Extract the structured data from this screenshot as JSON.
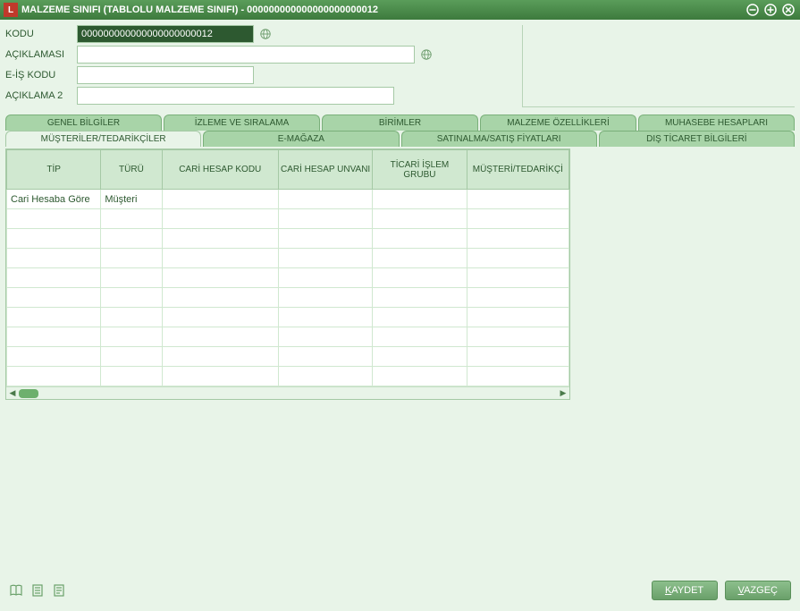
{
  "titlebar": {
    "title": "MALZEME SINIFI (TABLOLU MALZEME SINIFI) - 000000000000000000000012"
  },
  "form": {
    "kodu_label": "KODU",
    "kodu_value": "000000000000000000000012",
    "aciklamasi_label": "AÇIKLAMASI",
    "aciklamasi_value": "",
    "eiskodu_label": "E-İŞ KODU",
    "eiskodu_value": "",
    "aciklama2_label": "AÇIKLAMA 2",
    "aciklama2_value": ""
  },
  "tabs_row1": [
    {
      "label": "GENEL BİLGİLER"
    },
    {
      "label": "İZLEME VE SIRALAMA"
    },
    {
      "label": "BİRİMLER"
    },
    {
      "label": "MALZEME ÖZELLİKLERİ"
    },
    {
      "label": "MUHASEBE HESAPLARI"
    }
  ],
  "tabs_row2": [
    {
      "label": "MÜŞTERİLER/TEDARİKÇİLER",
      "active": true
    },
    {
      "label": "E-MAĞAZA"
    },
    {
      "label": "SATINALMA/SATIŞ FİYATLARI"
    },
    {
      "label": "DIŞ TİCARET BİLGİLERİ"
    }
  ],
  "grid": {
    "columns": [
      "TİP",
      "TÜRÜ",
      "CARİ HESAP KODU",
      "CARİ HESAP UNVANI",
      "TİCARİ İŞLEM GRUBU",
      "MÜŞTERİ/TEDARİKÇİ"
    ],
    "rows": [
      {
        "tip": "Cari Hesaba Göre",
        "turu": "Müşteri",
        "chk": "",
        "chu": "",
        "tig": "",
        "mt": ""
      },
      {
        "tip": "",
        "turu": "",
        "chk": "",
        "chu": "",
        "tig": "",
        "mt": ""
      },
      {
        "tip": "",
        "turu": "",
        "chk": "",
        "chu": "",
        "tig": "",
        "mt": ""
      },
      {
        "tip": "",
        "turu": "",
        "chk": "",
        "chu": "",
        "tig": "",
        "mt": ""
      },
      {
        "tip": "",
        "turu": "",
        "chk": "",
        "chu": "",
        "tig": "",
        "mt": ""
      },
      {
        "tip": "",
        "turu": "",
        "chk": "",
        "chu": "",
        "tig": "",
        "mt": ""
      },
      {
        "tip": "",
        "turu": "",
        "chk": "",
        "chu": "",
        "tig": "",
        "mt": ""
      },
      {
        "tip": "",
        "turu": "",
        "chk": "",
        "chu": "",
        "tig": "",
        "mt": ""
      },
      {
        "tip": "",
        "turu": "",
        "chk": "",
        "chu": "",
        "tig": "",
        "mt": ""
      },
      {
        "tip": "",
        "turu": "",
        "chk": "",
        "chu": "",
        "tig": "",
        "mt": ""
      }
    ]
  },
  "footer": {
    "save_label": "AYDET",
    "cancel_label": "AZGEÇ"
  }
}
